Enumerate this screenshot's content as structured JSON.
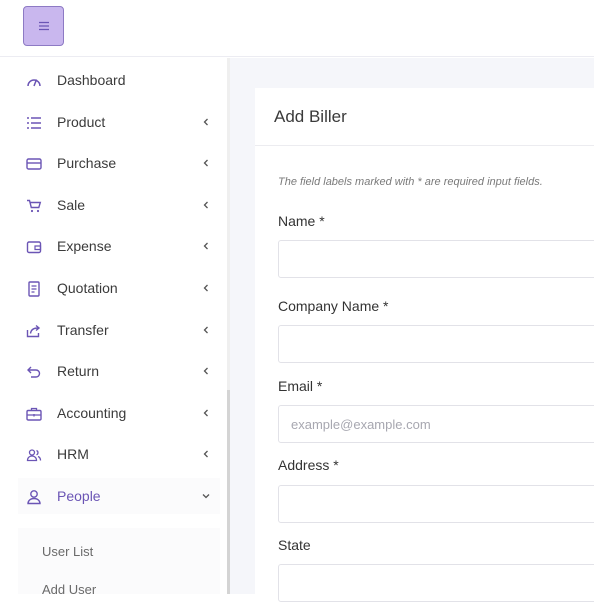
{
  "header": {
    "menu_icon": "hamburger-icon"
  },
  "sidebar": {
    "items": [
      {
        "label": "Dashboard",
        "icon": "gauge-icon",
        "has_children": false
      },
      {
        "label": "Product",
        "icon": "list-icon",
        "has_children": true
      },
      {
        "label": "Purchase",
        "icon": "card-icon",
        "has_children": true
      },
      {
        "label": "Sale",
        "icon": "cart-icon",
        "has_children": true
      },
      {
        "label": "Expense",
        "icon": "wallet-icon",
        "has_children": true
      },
      {
        "label": "Quotation",
        "icon": "document-icon",
        "has_children": true
      },
      {
        "label": "Transfer",
        "icon": "share-icon",
        "has_children": true
      },
      {
        "label": "Return",
        "icon": "return-icon",
        "has_children": true
      },
      {
        "label": "Accounting",
        "icon": "briefcase-icon",
        "has_children": true
      },
      {
        "label": "HRM",
        "icon": "users-icon",
        "has_children": true
      },
      {
        "label": "People",
        "icon": "user-icon",
        "has_children": true,
        "expanded": true
      }
    ],
    "people_submenu": [
      {
        "label": "User List"
      },
      {
        "label": "Add User"
      }
    ]
  },
  "form": {
    "title": "Add Biller",
    "note": "The field labels marked with * are required input fields.",
    "name_label": "Name *",
    "name_value": "",
    "company_label": "Company Name *",
    "company_value": "",
    "email_label": "Email *",
    "email_placeholder": "example@example.com",
    "address_label": "Address *",
    "address_value": "",
    "state_label": "State",
    "state_value": ""
  },
  "colors": {
    "accent": "#6b55b5",
    "menu_button_bg": "#c9b7ee",
    "icon_color": "#6b55b5"
  }
}
